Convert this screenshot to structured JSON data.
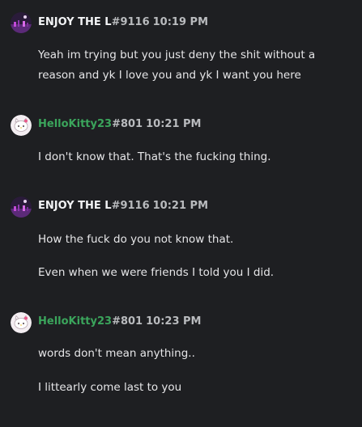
{
  "colors": {
    "background": "#1e1f22",
    "username_default": "#f2f3f5",
    "username_green": "#3ba55c",
    "meta_text": "#b9bbbe",
    "message_text": "#e6e6e8"
  },
  "messages": [
    {
      "avatar_icon": "dark-purple-avatar-icon",
      "username": "ENJOY THE L",
      "discriminator": "#9116",
      "time": "10:19 PM",
      "lines": [
        "Yeah im trying but you just deny the shit without a reason and yk I love you and yk I want you here"
      ]
    },
    {
      "avatar_icon": "hello-kitty-avatar-icon",
      "username": "HelloKitty23",
      "discriminator": "#801",
      "time": "10:21 PM",
      "lines": [
        "I don't know that. That's the fucking thing."
      ]
    },
    {
      "avatar_icon": "dark-purple-avatar-icon",
      "username": "ENJOY THE L",
      "discriminator": "#9116",
      "time": "10:21 PM",
      "lines": [
        "How the fuck do you not know that.",
        "Even when we were friends I told you I did."
      ]
    },
    {
      "avatar_icon": "hello-kitty-avatar-icon",
      "username": "HelloKitty23",
      "discriminator": "#801",
      "time": "10:23 PM",
      "lines": [
        "words don't mean anything..",
        "I littearly come last to you"
      ]
    }
  ]
}
